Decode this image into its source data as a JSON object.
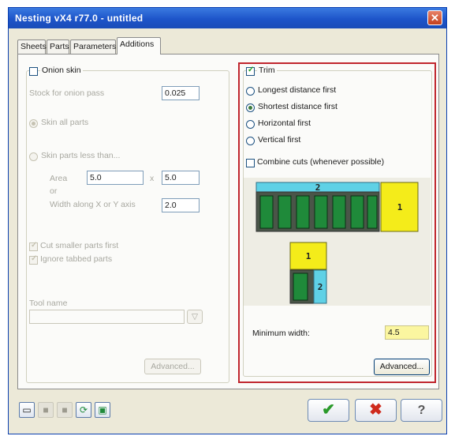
{
  "window": {
    "title": "Nesting vX4 r77.0 - untitled",
    "close_symbol": "✕"
  },
  "tabs": [
    "Sheets",
    "Parts",
    "Parameters",
    "Additions"
  ],
  "onion_skin": {
    "label": "Onion skin",
    "stock_label": "Stock for onion pass",
    "stock_value": "0.025",
    "skin_all": "Skin all parts",
    "skin_less": "Skin parts less than...",
    "area_label": "Area",
    "area_x": "5.0",
    "area_sep": "x",
    "or_label": "or",
    "width_label": "Width along X or Y axis",
    "width_value": "2.0",
    "cut_smaller": "Cut smaller parts first",
    "ignore_tabbed": "Ignore tabbed parts",
    "tool_name_label": "Tool name",
    "tool_name_value": "",
    "area_y": "5.0",
    "advanced_label": "Advanced..."
  },
  "trim": {
    "label": "Trim",
    "options": [
      "Longest distance first",
      "Shortest distance first",
      "Horizontal first",
      "Vertical first"
    ],
    "selected_option": "Shortest distance first",
    "combine_label": "Combine cuts (whenever possible)",
    "min_width_label": "Minimum width:",
    "min_width_value": "4.5",
    "advanced_label": "Advanced..."
  },
  "diagram": {
    "top_label": "2",
    "right_label": "1",
    "lower_top_label": "1",
    "lower_right_label": "2"
  },
  "bottom_bar": {
    "ok_symbol": "✔",
    "cancel_symbol": "✖",
    "help_symbol": "?"
  },
  "colors": {
    "accent_frame": "#c0262e",
    "part_green": "#1f8a3a",
    "trim_yellow": "#f4ec1a",
    "trim_cyan": "#5fd1e6"
  }
}
